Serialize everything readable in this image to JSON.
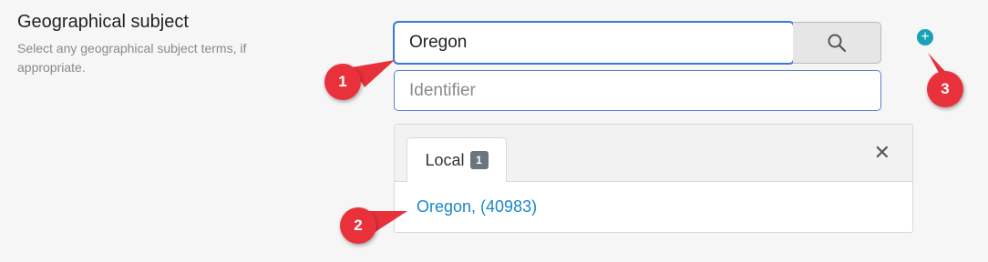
{
  "field": {
    "label": "Geographical subject",
    "help": "Select any geographical subject terms, if appropriate."
  },
  "search": {
    "value": "Oregon",
    "button_icon": "search-icon"
  },
  "identifier": {
    "placeholder": "Identifier"
  },
  "add_button": {
    "icon": "plus-circle-icon",
    "color": "#17a2b8"
  },
  "results": {
    "tab_label": "Local",
    "tab_count": "1",
    "close_icon": "close-icon",
    "items": [
      {
        "label": "Oregon, (40983)"
      }
    ]
  },
  "markers": {
    "one": "1",
    "two": "2",
    "three": "3",
    "color": "#e8313b"
  }
}
